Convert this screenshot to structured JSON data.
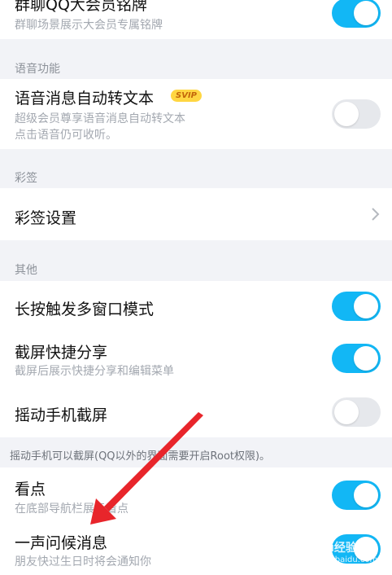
{
  "rows": {
    "group_badge": {
      "title": "群聊QQ大会员铭牌",
      "subtitle": "群聊场景展示大会员专属铭牌",
      "enabled": true
    },
    "voice_section": "语音功能",
    "voice_to_text": {
      "title": "语音消息自动转文本",
      "badge": "SVIP",
      "subtitle_line1": "超级会员尊享语音消息自动转文本",
      "subtitle_line2": "点击语音仍可收听。",
      "enabled": false
    },
    "caiqian_section": "彩签",
    "caiqian_settings": {
      "title": "彩签设置",
      "chevron": "chevron-right-icon"
    },
    "other_section": "其他",
    "long_press_multiwindow": {
      "title": "长按触发多窗口模式",
      "enabled": true
    },
    "screenshot_share": {
      "title": "截屏快捷分享",
      "subtitle": "截屏后展示快捷分享和编辑菜单",
      "enabled": true
    },
    "shake_screenshot": {
      "title": "摇动手机截屏",
      "enabled": false
    },
    "shake_note": "摇动手机可以截屏(QQ以外的界面需要开启Root权限)。",
    "kandian": {
      "title": "看点",
      "subtitle": "在底部导航栏展示看点",
      "enabled": true
    },
    "greeting": {
      "title": "一声问候消息",
      "subtitle": "朋友快过生日时将会通知你",
      "enabled": true
    }
  },
  "overlay": {
    "arrow_color": "#e8252b",
    "watermark": "Baidu经验",
    "watermark_url": "jingyan.baidu.com"
  },
  "colors": {
    "toggle_on": "#12b7f5",
    "toggle_off": "#e6e8ec",
    "background": "#f2f3f7"
  }
}
